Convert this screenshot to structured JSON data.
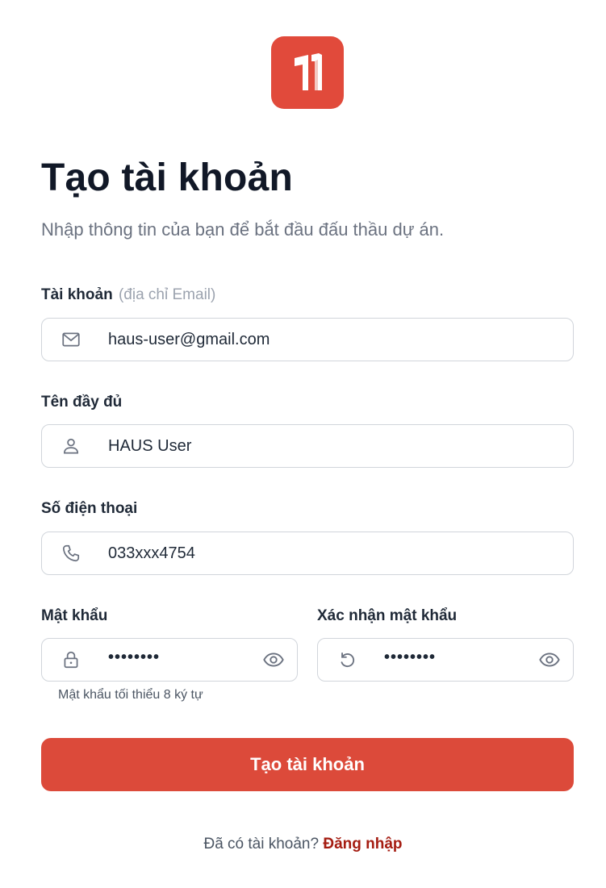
{
  "brand": {
    "color": "#e14a3b",
    "logo_icon": "brand-logo-icon"
  },
  "header": {
    "title": "Tạo tài khoản",
    "subtitle": "Nhập thông tin của bạn để bắt đầu đấu thầu dự án."
  },
  "form": {
    "email": {
      "label": "Tài khoản",
      "hint": "(địa chỉ Email)",
      "value": "haus-user@gmail.com",
      "icon": "mail-icon"
    },
    "full_name": {
      "label": "Tên đầy đủ",
      "value": "HAUS User",
      "icon": "user-icon"
    },
    "phone": {
      "label": "Số điện thoại",
      "value": "033xxx4754",
      "icon": "phone-icon"
    },
    "password": {
      "label": "Mật khẩu",
      "value": "••••••••",
      "icon": "lock-icon",
      "toggle_icon": "eye-icon",
      "helper": "Mật khẩu tối thiểu 8 ký tự"
    },
    "confirm_password": {
      "label": "Xác nhận mật khẩu",
      "value": "••••••••",
      "icon": "refresh-icon",
      "toggle_icon": "eye-icon"
    },
    "submit_label": "Tạo tài khoản"
  },
  "footer": {
    "prompt": "Đã có tài khoản?",
    "link": "Đăng nhập"
  },
  "colors": {
    "primary_button": "#dc4a3a",
    "link": "#a51d12",
    "border": "#d1d5db",
    "muted_text": "#6b7280"
  }
}
